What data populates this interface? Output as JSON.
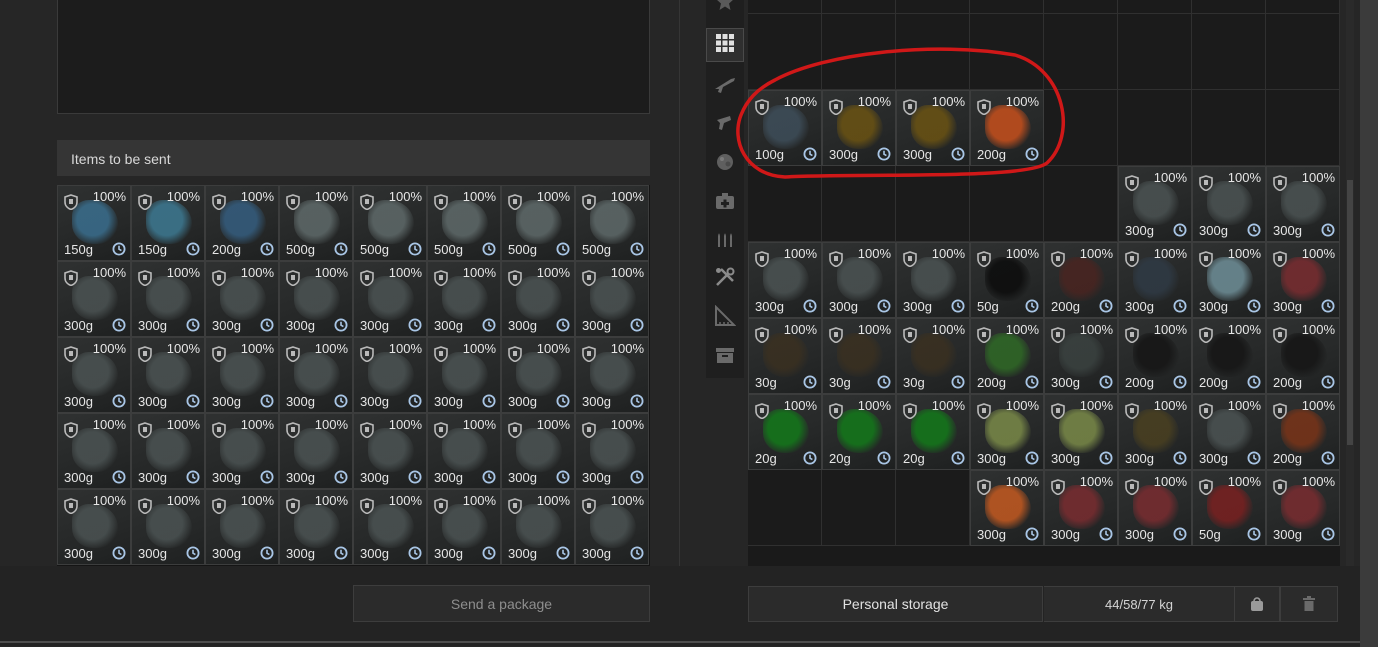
{
  "items_header": "Items to be sent",
  "send_button": "Send a package",
  "storage_button": "Personal storage",
  "weight_readout": "44/58/77 kg",
  "sidebar": {
    "icons": [
      "star-icon",
      "grid-icon",
      "rifle-icon",
      "pistol-icon",
      "artifact-icon",
      "medkit-icon",
      "ammo-icon",
      "tools-icon",
      "ruler-icon",
      "archive-icon"
    ],
    "active": "grid-icon"
  },
  "colors": {
    "accent_red": "#d01818",
    "cell_border_green": "#3c6b3c"
  },
  "left_items": [
    {
      "pct": "100%",
      "weight": "150g",
      "color": "#3a6f8f"
    },
    {
      "pct": "100%",
      "weight": "150g",
      "color": "#3d7a93"
    },
    {
      "pct": "100%",
      "weight": "200g",
      "color": "#355e80"
    },
    {
      "pct": "100%",
      "weight": "500g",
      "color": "#5f6a6a"
    },
    {
      "pct": "100%",
      "weight": "500g",
      "color": "#5f6a6a"
    },
    {
      "pct": "100%",
      "weight": "500g",
      "color": "#5f6a6a"
    },
    {
      "pct": "100%",
      "weight": "500g",
      "color": "#5f6a6a"
    },
    {
      "pct": "100%",
      "weight": "500g",
      "color": "#5f6a6a"
    },
    {
      "pct": "100%",
      "weight": "300g",
      "color": "#4b5353"
    },
    {
      "pct": "100%",
      "weight": "300g",
      "color": "#4b5353"
    },
    {
      "pct": "100%",
      "weight": "300g",
      "color": "#4b5353"
    },
    {
      "pct": "100%",
      "weight": "300g",
      "color": "#4b5353"
    },
    {
      "pct": "100%",
      "weight": "300g",
      "color": "#4b5353"
    },
    {
      "pct": "100%",
      "weight": "300g",
      "color": "#4b5353"
    },
    {
      "pct": "100%",
      "weight": "300g",
      "color": "#4b5353"
    },
    {
      "pct": "100%",
      "weight": "300g",
      "color": "#4b5353"
    },
    {
      "pct": "100%",
      "weight": "300g",
      "color": "#4b5353"
    },
    {
      "pct": "100%",
      "weight": "300g",
      "color": "#4b5353"
    },
    {
      "pct": "100%",
      "weight": "300g",
      "color": "#4b5353"
    },
    {
      "pct": "100%",
      "weight": "300g",
      "color": "#4b5353"
    },
    {
      "pct": "100%",
      "weight": "300g",
      "color": "#4b5353"
    },
    {
      "pct": "100%",
      "weight": "300g",
      "color": "#4b5353"
    },
    {
      "pct": "100%",
      "weight": "300g",
      "color": "#4b5353"
    },
    {
      "pct": "100%",
      "weight": "300g",
      "color": "#4b5353"
    },
    {
      "pct": "100%",
      "weight": "300g",
      "color": "#4b5353"
    },
    {
      "pct": "100%",
      "weight": "300g",
      "color": "#4b5353"
    },
    {
      "pct": "100%",
      "weight": "300g",
      "color": "#4b5353"
    },
    {
      "pct": "100%",
      "weight": "300g",
      "color": "#4b5353"
    },
    {
      "pct": "100%",
      "weight": "300g",
      "color": "#4b5353"
    },
    {
      "pct": "100%",
      "weight": "300g",
      "color": "#4b5353"
    },
    {
      "pct": "100%",
      "weight": "300g",
      "color": "#4b5353"
    },
    {
      "pct": "100%",
      "weight": "300g",
      "color": "#4b5353"
    },
    {
      "pct": "100%",
      "weight": "300g",
      "color": "#4b5353"
    },
    {
      "pct": "100%",
      "weight": "300g",
      "color": "#4b5353"
    },
    {
      "pct": "100%",
      "weight": "300g",
      "color": "#4b5353"
    },
    {
      "pct": "100%",
      "weight": "300g",
      "color": "#4b5353"
    },
    {
      "pct": "100%",
      "weight": "300g",
      "color": "#4b5353"
    },
    {
      "pct": "100%",
      "weight": "300g",
      "color": "#4b5353"
    },
    {
      "pct": "100%",
      "weight": "300g",
      "color": "#4b5353"
    },
    {
      "pct": "100%",
      "weight": "300g",
      "color": "#4b5353"
    }
  ],
  "right_rows": [
    [
      null,
      null,
      null,
      null,
      null,
      null,
      null,
      null
    ],
    [
      null,
      null,
      null,
      null,
      null,
      null,
      null,
      null
    ],
    [
      {
        "pct": "100%",
        "weight": "100g",
        "color": "#3e4e5a"
      },
      {
        "pct": "100%",
        "weight": "300g",
        "color": "#6b5312"
      },
      {
        "pct": "100%",
        "weight": "300g",
        "color": "#6b5312"
      },
      {
        "pct": "100%",
        "weight": "200g",
        "color": "#c8501c"
      },
      null,
      null,
      null,
      null
    ],
    [
      null,
      null,
      null,
      null,
      null,
      {
        "pct": "100%",
        "weight": "300g",
        "color": "#4b5353"
      },
      {
        "pct": "100%",
        "weight": "300g",
        "color": "#4b5353"
      },
      {
        "pct": "100%",
        "weight": "300g",
        "color": "#4b5353"
      }
    ],
    [
      {
        "pct": "100%",
        "weight": "300g",
        "color": "#4b5353"
      },
      {
        "pct": "100%",
        "weight": "300g",
        "color": "#4b5353"
      },
      {
        "pct": "100%",
        "weight": "300g",
        "color": "#4b5353"
      },
      {
        "pct": "100%",
        "weight": "50g",
        "color": "#0c0c0c"
      },
      {
        "pct": "100%",
        "weight": "200g",
        "color": "#4a2420"
      },
      {
        "pct": "100%",
        "weight": "300g",
        "color": "#2f3a45"
      },
      {
        "pct": "100%",
        "weight": "300g",
        "color": "#6f8f98"
      },
      {
        "pct": "100%",
        "weight": "300g",
        "color": "#7a2c30"
      }
    ],
    [
      {
        "pct": "100%",
        "weight": "30g",
        "color": "#3a3020"
      },
      {
        "pct": "100%",
        "weight": "30g",
        "color": "#3a3020"
      },
      {
        "pct": "100%",
        "weight": "30g",
        "color": "#3a3020"
      },
      {
        "pct": "100%",
        "weight": "200g",
        "color": "#2f6a26"
      },
      {
        "pct": "100%",
        "weight": "300g",
        "color": "#3a4240"
      },
      {
        "pct": "100%",
        "weight": "200g",
        "color": "#151515"
      },
      {
        "pct": "100%",
        "weight": "200g",
        "color": "#151515"
      },
      {
        "pct": "100%",
        "weight": "200g",
        "color": "#151515"
      }
    ],
    [
      {
        "pct": "100%",
        "weight": "20g",
        "color": "#137a1a"
      },
      {
        "pct": "100%",
        "weight": "20g",
        "color": "#137a1a"
      },
      {
        "pct": "100%",
        "weight": "20g",
        "color": "#137a1a"
      },
      {
        "pct": "100%",
        "weight": "300g",
        "color": "#7a8a48"
      },
      {
        "pct": "100%",
        "weight": "300g",
        "color": "#7a8a48"
      },
      {
        "pct": "100%",
        "weight": "300g",
        "color": "#4a4020"
      },
      {
        "pct": "100%",
        "weight": "300g",
        "color": "#4b5353"
      },
      {
        "pct": "100%",
        "weight": "200g",
        "color": "#7a3418"
      }
    ],
    [
      null,
      null,
      null,
      {
        "pct": "100%",
        "weight": "300g",
        "color": "#c55a20"
      },
      {
        "pct": "100%",
        "weight": "300g",
        "color": "#7a2c30"
      },
      {
        "pct": "100%",
        "weight": "300g",
        "color": "#7a2c30"
      },
      {
        "pct": "100%",
        "weight": "50g",
        "color": "#7a2020"
      },
      {
        "pct": "100%",
        "weight": "300g",
        "color": "#7a2c30"
      }
    ]
  ]
}
